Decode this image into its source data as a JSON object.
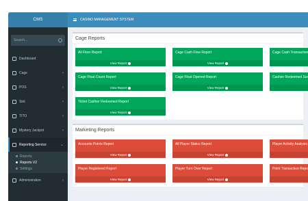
{
  "app": {
    "logo": "CMS"
  },
  "header": {
    "breadcrumb": "CASINO MANAGEMENT SYSTEM"
  },
  "sidebar": {
    "search_placeholder": "Search...",
    "items": [
      {
        "label": "Dashboard"
      },
      {
        "label": "Cage"
      },
      {
        "label": "POS"
      },
      {
        "label": "Slot"
      },
      {
        "label": "TITO"
      },
      {
        "label": "Mystery Jackpot"
      },
      {
        "label": "Reporting Service"
      }
    ],
    "submenu": [
      {
        "label": "Reports"
      },
      {
        "label": "Reports V2"
      },
      {
        "label": "Settings"
      }
    ],
    "admin": {
      "label": "Administration"
    }
  },
  "sections": {
    "cage": {
      "title": "Cage Reports",
      "tiles": [
        {
          "title": "All Floor Report",
          "footer": "View Report"
        },
        {
          "title": "Cage Cash Flow Report",
          "footer": "View Report"
        },
        {
          "title": "Cage Cash Transaction Type",
          "footer": "View"
        },
        {
          "title": "Cage Float Count Report",
          "footer": "View Report"
        },
        {
          "title": "Cage Float Opened Report",
          "footer": "View Report"
        },
        {
          "title": "Cashier Redeemed Summary",
          "footer": "View"
        },
        {
          "title": "Ticket Cashier Redeemed Report",
          "footer": "View Report"
        }
      ]
    },
    "marketing": {
      "title": "Marketing Reports",
      "tiles": [
        {
          "title": "Accounts Points Report",
          "footer": "View Report"
        },
        {
          "title": "All Player Status Report",
          "footer": "View Report"
        },
        {
          "title": "Player Activity Analysis Rep",
          "footer": "View"
        },
        {
          "title": "Player Registered Report",
          "footer": "View Report"
        },
        {
          "title": "Player Turn Over Report",
          "footer": "View Report"
        },
        {
          "title": "Point Transaction Report",
          "footer": "View"
        }
      ]
    }
  },
  "colors": {
    "green": "#00a65a",
    "red": "#dd4b39",
    "header": "#3c8dbc",
    "sidebar": "#222d32"
  }
}
